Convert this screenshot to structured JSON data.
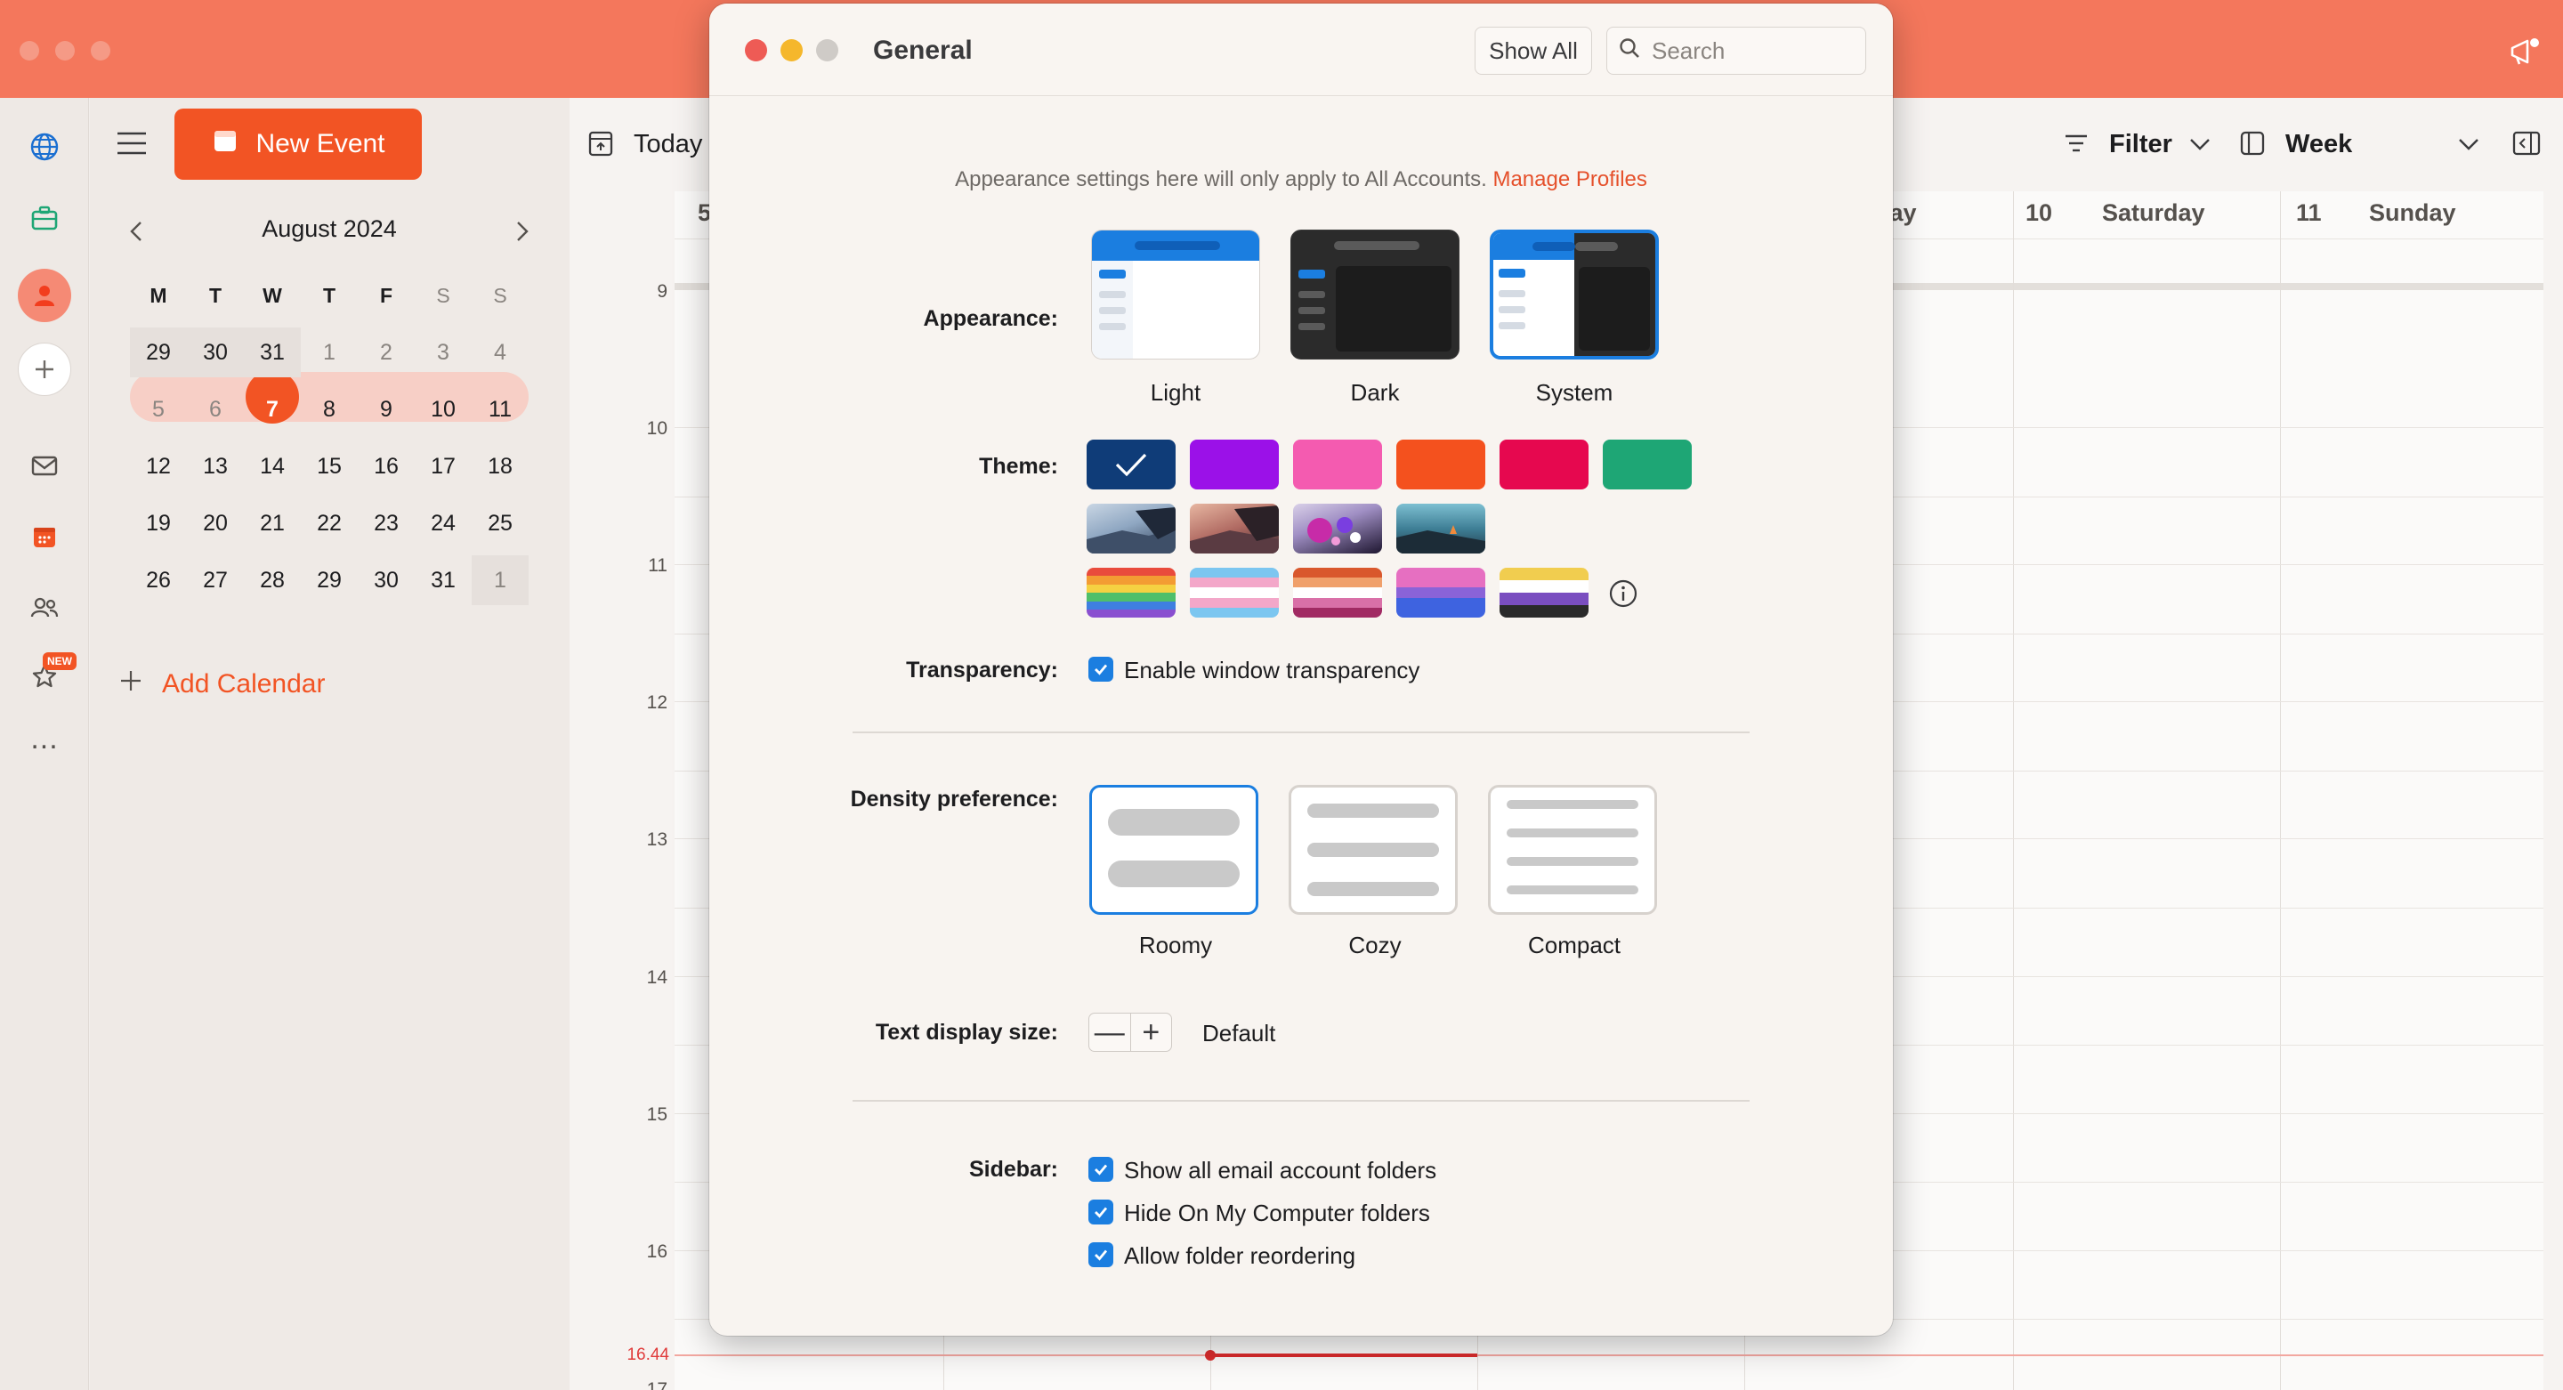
{
  "toolbar": {
    "new_event": "New Event",
    "today": "Today",
    "filter": "Filter",
    "week": "Week"
  },
  "mini_calendar": {
    "month": "August 2024",
    "weekdays": [
      "M",
      "T",
      "W",
      "T",
      "F",
      "S",
      "S"
    ],
    "weeks": [
      [
        "29",
        "30",
        "31",
        "1",
        "2",
        "3",
        "4"
      ],
      [
        "5",
        "6",
        "7",
        "8",
        "9",
        "10",
        "11"
      ],
      [
        "12",
        "13",
        "14",
        "15",
        "16",
        "17",
        "18"
      ],
      [
        "19",
        "20",
        "21",
        "22",
        "23",
        "24",
        "25"
      ],
      [
        "26",
        "27",
        "28",
        "29",
        "30",
        "31",
        "1"
      ]
    ],
    "today": "7"
  },
  "rail": {
    "new_badge": "NEW",
    "more": "..."
  },
  "sidebar": {
    "add_calendar": "Add Calendar"
  },
  "calendar_view": {
    "days": [
      {
        "num": "5",
        "name": ""
      },
      {
        "num": "",
        "name": "lay"
      },
      {
        "num": "10",
        "name": "Saturday"
      },
      {
        "num": "11",
        "name": "Sunday"
      }
    ],
    "hours": [
      "9",
      "10",
      "11",
      "12",
      "13",
      "14",
      "15",
      "16",
      "17"
    ],
    "now_label": "16.44"
  },
  "dialog": {
    "title": "General",
    "show_all": "Show All",
    "search_placeholder": "Search",
    "note_text": "Appearance settings here will only apply to All Accounts.",
    "manage_profiles": "Manage Profiles",
    "appearance_label": "Appearance:",
    "appearance_options": [
      "Light",
      "Dark",
      "System"
    ],
    "appearance_selected": "System",
    "theme_label": "Theme:",
    "theme_colors": [
      "#0f3c78",
      "#9b11e8",
      "#f45bb0",
      "#f4511e",
      "#e6084f",
      "#1ea675"
    ],
    "transparency_label": "Transparency:",
    "transparency_option": "Enable window transparency",
    "transparency_checked": true,
    "density_label": "Density preference:",
    "density_options": [
      "Roomy",
      "Cozy",
      "Compact"
    ],
    "density_selected": "Roomy",
    "text_size_label": "Text display size:",
    "text_size_minus": "—",
    "text_size_plus": "+",
    "text_size_value": "Default",
    "sidebar_label": "Sidebar:",
    "sidebar_options": [
      {
        "label": "Show all email account folders",
        "checked": true
      },
      {
        "label": "Hide On My Computer folders",
        "checked": true
      },
      {
        "label": "Allow folder reordering",
        "checked": true
      }
    ]
  },
  "colors": {
    "accent": "#f25424",
    "titlebar": "#f4775c",
    "checkbox": "#1b7ee0",
    "now_line": "#e03b3b"
  }
}
